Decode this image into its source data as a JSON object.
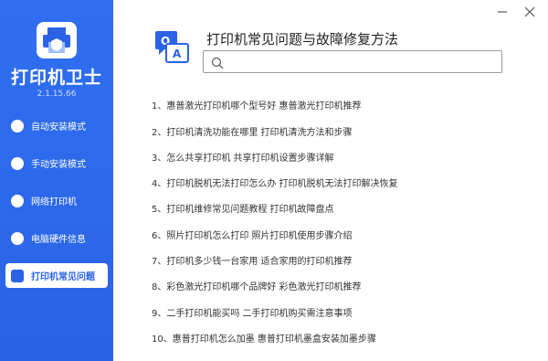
{
  "app": {
    "name": "打印机卫士",
    "version": "2.1.15.66"
  },
  "window": {
    "minimize_icon": "minimize-icon",
    "close_icon": "close-icon"
  },
  "sidebar": {
    "items": [
      {
        "label": "自动安装模式",
        "icon": "auto-install-icon",
        "active": false
      },
      {
        "label": "手动安装模式",
        "icon": "wrench-icon",
        "active": false
      },
      {
        "label": "网络打印机",
        "icon": "network-icon",
        "active": false
      },
      {
        "label": "电脑硬件信息",
        "icon": "hardware-icon",
        "active": false
      },
      {
        "label": "打印机常见问题",
        "icon": "faq-icon",
        "active": true
      }
    ]
  },
  "main": {
    "title": "打印机常见问题与故障修复方法",
    "search": {
      "value": "",
      "placeholder": ""
    },
    "faq": [
      "1、惠普激光打印机哪个型号好 惠普激光打印机推荐",
      "2、打印机清洗功能在哪里 打印机清洗方法和步骤",
      "3、怎么共享打印机 共享打印机设置步骤详解",
      "4、打印机脱机无法打印怎么办 打印机脱机无法打印解决恢复",
      "5、打印机维修常见问题教程 打印机故障盘点",
      "6、照片打印机怎么打印 照片打印机使用步骤介绍",
      "7、打印机多少钱一台家用 适合家用的打印机推荐",
      "8、彩色激光打印机哪个品牌好 彩色激光打印机推荐",
      "9、二手打印机能买吗 二手打印机购买需注意事项",
      "10、惠普打印机怎么加墨 惠普打印机墨盒安装加墨步骤"
    ]
  },
  "colors": {
    "accent": "#2a63e6",
    "text": "#333333"
  }
}
